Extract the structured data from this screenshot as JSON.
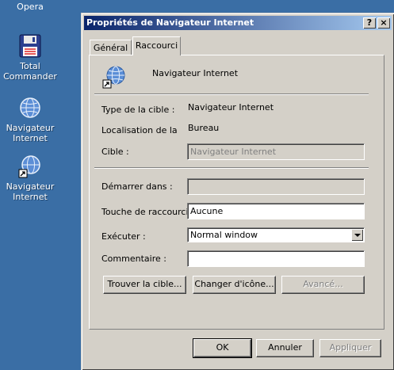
{
  "desktop": {
    "opera_label": "Opera",
    "icons": [
      {
        "label_line1": "Total",
        "label_line2": "Commander",
        "icon": "floppy-disk-icon"
      },
      {
        "label_line1": "Navigateur",
        "label_line2": "Internet",
        "icon": "globe-icon"
      },
      {
        "label_line1": "Navigateur",
        "label_line2": "Internet",
        "icon": "globe-shortcut-icon"
      }
    ]
  },
  "dialog": {
    "title": "Propriétés de Navigateur Internet",
    "title_buttons": {
      "help": "?",
      "close": "×"
    },
    "tabs": [
      "Général",
      "Raccourci"
    ],
    "active_tab": "Raccourci",
    "shortcut_name": "Navigateur Internet",
    "target_type_label": "Type de la cible :",
    "target_type_value": "Navigateur Internet",
    "target_location_label": "Localisation de la",
    "target_location_value": "Bureau",
    "target_label": "Cible :",
    "target_value": "Navigateur Internet",
    "start_in_label": "Démarrer dans :",
    "start_in_value": "",
    "hotkey_label": "Touche de raccourci :",
    "hotkey_value": "Aucune",
    "run_label": "Exécuter :",
    "run_value": "Normal window",
    "comment_label": "Commentaire :",
    "comment_value": "",
    "find_target_button": "Trouver la cible...",
    "change_icon_button": "Changer d'icône...",
    "advanced_button": "Avancé...",
    "ok_button": "OK",
    "cancel_button": "Annuler",
    "apply_button": "Appliquer"
  },
  "colors": {
    "desktop": "#3a6ea5",
    "dialog_face": "#d4d0c8",
    "title_start": "#0a246a",
    "title_end": "#a6caf0"
  }
}
